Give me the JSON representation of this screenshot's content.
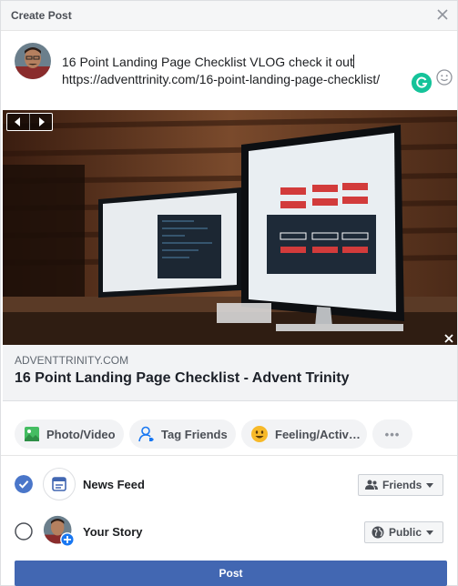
{
  "header": {
    "title": "Create Post"
  },
  "composer": {
    "text_line1": "16 Point Landing Page Checklist VLOG check it out",
    "text_line2": "https://adventtrinity.com/16-point-landing-page-checklist/"
  },
  "link_preview": {
    "domain": "ADVENTTRINITY.COM",
    "title": "16 Point Landing Page Checklist - Advent Trinity"
  },
  "actions": [
    {
      "label": "Photo/Video",
      "icon": "photo-icon"
    },
    {
      "label": "Tag Friends",
      "icon": "tag-friends-icon"
    },
    {
      "label": "Feeling/Activ…",
      "icon": "feeling-emoji-icon"
    },
    {
      "label": "•••",
      "icon": "more-icon"
    }
  ],
  "share": {
    "news_feed": {
      "label": "News Feed",
      "audience": "Friends",
      "checked": true
    },
    "your_story": {
      "label": "Your Story",
      "audience": "Public",
      "checked": false
    }
  },
  "post_button": {
    "label": "Post"
  },
  "colors": {
    "brand_blue": "#4267b2",
    "check_blue": "#4a76c9",
    "grammarly_green": "#15c39a"
  }
}
